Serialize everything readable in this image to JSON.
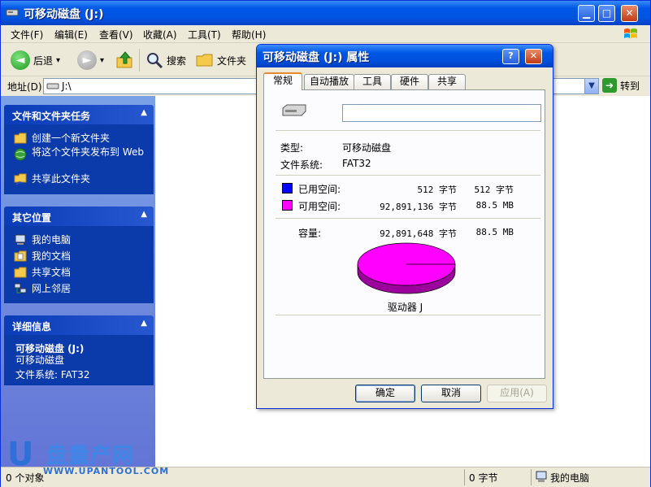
{
  "window": {
    "title": "可移动磁盘 (J:)",
    "caption_min": "▁",
    "caption_max": "□",
    "caption_close": "✕"
  },
  "menubar": {
    "items": [
      "文件(F)",
      "编辑(E)",
      "查看(V)",
      "收藏(A)",
      "工具(T)",
      "帮助(H)"
    ]
  },
  "toolbar": {
    "back_label": "后退",
    "back_arrow": "◄",
    "dropdown_arrow": "▾",
    "forward_arrow": "►",
    "search_label": "搜索",
    "folders_label": "文件夹"
  },
  "address": {
    "label": "地址(D)",
    "value": "J:\\",
    "dropdown_arrow": "▼",
    "go_arrow": "➜",
    "go_label": "转到"
  },
  "taskpane": {
    "file_tasks": {
      "title": "文件和文件夹任务",
      "chevron": "▲",
      "items": [
        "创建一个新文件夹",
        "将这个文件夹发布到 Web",
        "共享此文件夹"
      ]
    },
    "other_places": {
      "title": "其它位置",
      "chevron": "▲",
      "items": [
        "我的电脑",
        "我的文档",
        "共享文档",
        "网上邻居"
      ]
    },
    "details": {
      "title": "详细信息",
      "chevron": "▲",
      "name": "可移动磁盘 (J:)",
      "type": "可移动磁盘",
      "fs": "文件系统: FAT32"
    }
  },
  "statusbar": {
    "objects": "0 个对象",
    "size": "0 字节",
    "location": "我的电脑"
  },
  "watermark": {
    "u": "U",
    "cn": "盘量产网",
    "en": "WWW.UPANTOOL.COM"
  },
  "dialog": {
    "title": "可移动磁盘 (J:) 属性",
    "help_glyph": "?",
    "close_glyph": "✕",
    "tabs": [
      "常规",
      "自动播放",
      "工具",
      "硬件",
      "共享"
    ],
    "active_tab": 0,
    "name_value": "",
    "type_label": "类型:",
    "type_value": "可移动磁盘",
    "fs_label": "文件系统:",
    "fs_value": "FAT32",
    "used_label": "已用空间:",
    "used_bytes": "512 字节",
    "used_human": "512 字节",
    "free_label": "可用空间:",
    "free_bytes": "92,891,136 字节",
    "free_human": "88.5 MB",
    "capacity_label": "容量:",
    "capacity_bytes": "92,891,648 字节",
    "capacity_human": "88.5 MB",
    "drive_label": "驱动器 J",
    "ok": "确定",
    "cancel": "取消",
    "apply": "应用(A)",
    "colors": {
      "used": "#0000ff",
      "free": "#ff00ff"
    }
  },
  "chart_data": {
    "type": "pie",
    "categories": [
      "已用空间",
      "可用空间"
    ],
    "values": [
      512,
      92891136
    ],
    "colors": [
      "#0000ff",
      "#ff00ff"
    ]
  }
}
